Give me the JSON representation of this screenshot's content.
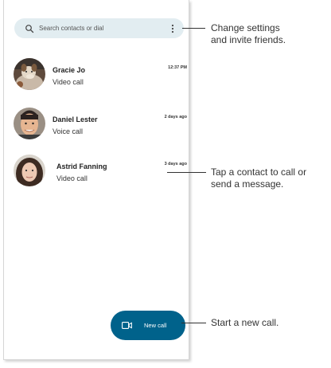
{
  "search": {
    "placeholder": "Search contacts or dial",
    "icon": "search-icon",
    "menu_icon": "more-vert-icon"
  },
  "calls": [
    {
      "name": "Gracie Jo",
      "type": "Video call",
      "time": "12:37 PM"
    },
    {
      "name": "Daniel Lester",
      "type": "Voice call",
      "time": "2 days ago"
    },
    {
      "name": "Astrid Fanning",
      "type": "Video call",
      "time": "3 days ago"
    }
  ],
  "fab": {
    "label": "New call",
    "icon": "video-call-icon",
    "color": "#00628b"
  },
  "callouts": {
    "settings_line1": "Change settings",
    "settings_line2": "and invite friends.",
    "contact_line1": "Tap a contact to call or",
    "contact_line2": "send a message.",
    "new_call": "Start a new call."
  },
  "colors": {
    "search_bg": "#e2edf1",
    "fab_bg": "#00628b"
  }
}
